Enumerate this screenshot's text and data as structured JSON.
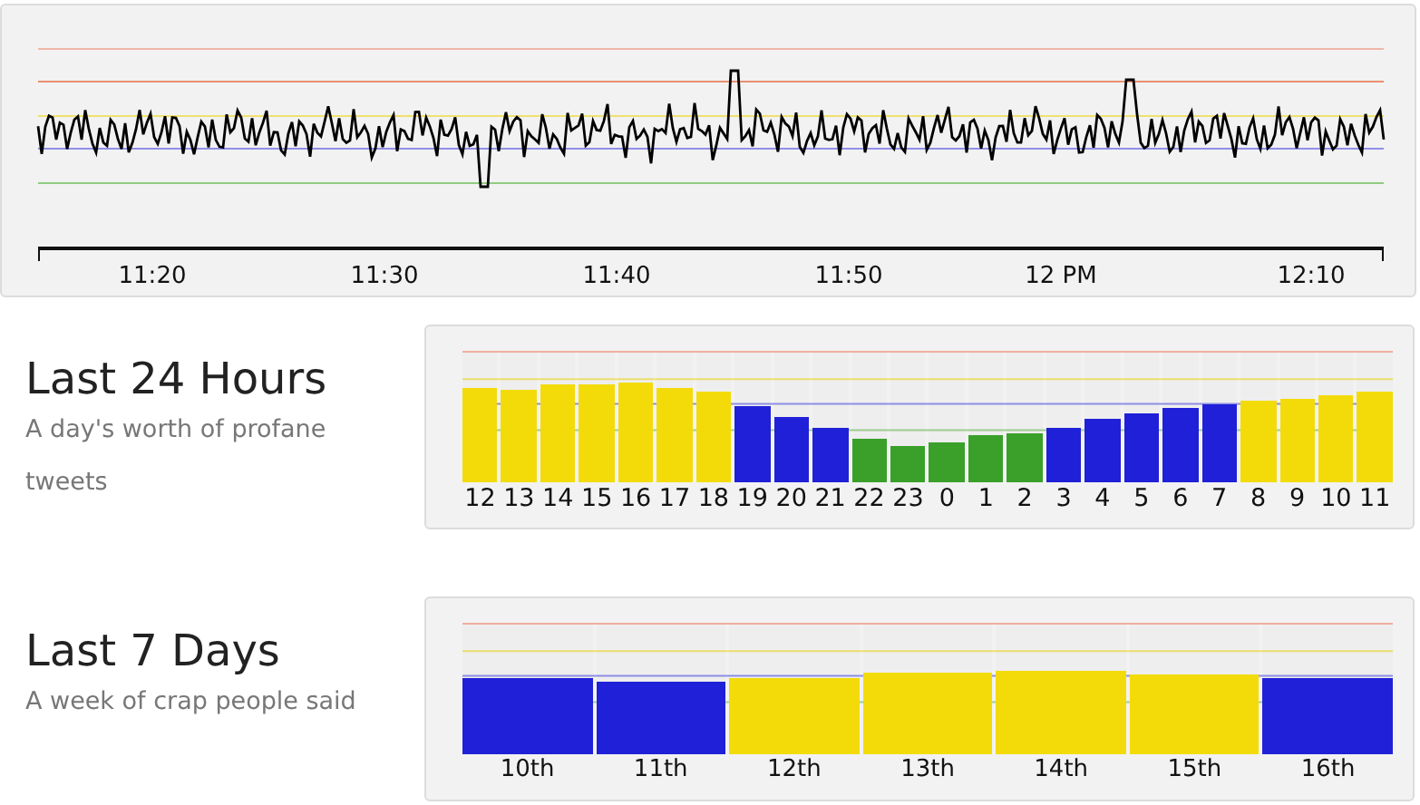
{
  "timeline": {
    "x_labels": [
      "11:20",
      "11:30",
      "11:40",
      "11:50",
      "12 PM",
      "12:10"
    ]
  },
  "sections": [
    {
      "title": "Last 24 Hours",
      "subtitle": "A day's worth of profane tweets",
      "kind": "hours",
      "bars": [
        {
          "label": "12",
          "level": 0.72,
          "color": "#f3db0a"
        },
        {
          "label": "13",
          "level": 0.71,
          "color": "#f3db0a"
        },
        {
          "label": "14",
          "level": 0.75,
          "color": "#f3db0a"
        },
        {
          "label": "15",
          "level": 0.75,
          "color": "#f3db0a"
        },
        {
          "label": "16",
          "level": 0.76,
          "color": "#f3db0a"
        },
        {
          "label": "17",
          "level": 0.72,
          "color": "#f3db0a"
        },
        {
          "label": "18",
          "level": 0.7,
          "color": "#f3db0a"
        },
        {
          "label": "19",
          "level": 0.59,
          "color": "#2020d8"
        },
        {
          "label": "20",
          "level": 0.5,
          "color": "#2020d8"
        },
        {
          "label": "21",
          "level": 0.42,
          "color": "#2020d8"
        },
        {
          "label": "22",
          "level": 0.33,
          "color": "#3aa02a"
        },
        {
          "label": "23",
          "level": 0.28,
          "color": "#3aa02a"
        },
        {
          "label": "0",
          "level": 0.3,
          "color": "#3aa02a"
        },
        {
          "label": "1",
          "level": 0.36,
          "color": "#3aa02a"
        },
        {
          "label": "2",
          "level": 0.38,
          "color": "#3aa02a"
        },
        {
          "label": "3",
          "level": 0.42,
          "color": "#2020d8"
        },
        {
          "label": "4",
          "level": 0.49,
          "color": "#2020d8"
        },
        {
          "label": "5",
          "level": 0.53,
          "color": "#2020d8"
        },
        {
          "label": "6",
          "level": 0.57,
          "color": "#2020d8"
        },
        {
          "label": "7",
          "level": 0.6,
          "color": "#2020d8"
        },
        {
          "label": "8",
          "level": 0.63,
          "color": "#f3db0a"
        },
        {
          "label": "9",
          "level": 0.64,
          "color": "#f3db0a"
        },
        {
          "label": "10",
          "level": 0.67,
          "color": "#f3db0a"
        },
        {
          "label": "11",
          "level": 0.69,
          "color": "#f3db0a"
        }
      ]
    },
    {
      "title": "Last 7 Days",
      "subtitle": "A week of crap people said",
      "kind": "days",
      "bars": [
        {
          "label": "10th",
          "level": 0.58,
          "color": "#2020d8"
        },
        {
          "label": "11th",
          "level": 0.56,
          "color": "#2020d8"
        },
        {
          "label": "12th",
          "level": 0.59,
          "color": "#f3db0a"
        },
        {
          "label": "13th",
          "level": 0.63,
          "color": "#f3db0a"
        },
        {
          "label": "14th",
          "level": 0.635,
          "color": "#f3db0a"
        },
        {
          "label": "15th",
          "level": 0.605,
          "color": "#f3db0a"
        },
        {
          "label": "16th",
          "level": 0.585,
          "color": "#2020d8"
        }
      ]
    }
  ]
}
